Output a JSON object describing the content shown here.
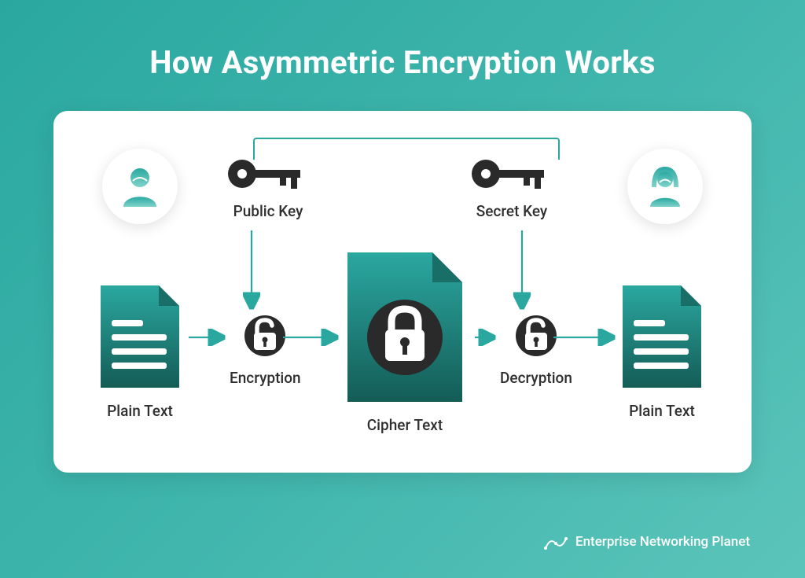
{
  "title": "How Asymmetric Encryption Works",
  "keys": {
    "public": "Public Key",
    "secret": "Secret Key"
  },
  "stages": {
    "plain_left": "Plain Text",
    "encryption": "Encryption",
    "cipher": "Cipher Text",
    "decryption": "Decryption",
    "plain_right": "Plain Text"
  },
  "branding": "Enterprise Networking Planet",
  "colors": {
    "bg_start": "#2aa8a0",
    "bg_end": "#5bc4ba",
    "card": "#ffffff",
    "text": "#2f2f2f",
    "arrow": "#2aa8a0",
    "icon_dark": "#2a2a2a"
  }
}
